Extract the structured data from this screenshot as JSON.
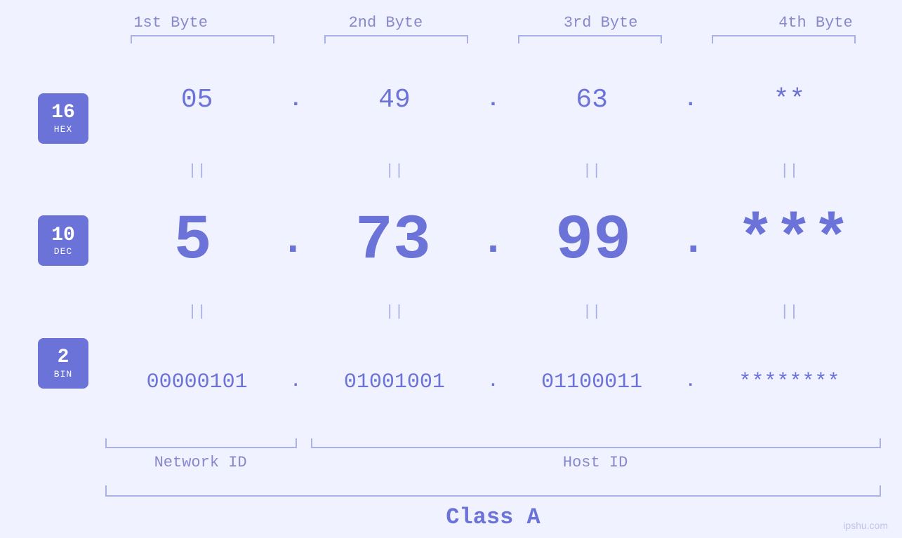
{
  "header": {
    "bytes": [
      {
        "label": "1st Byte"
      },
      {
        "label": "2nd Byte"
      },
      {
        "label": "3rd Byte"
      },
      {
        "label": "4th Byte"
      }
    ]
  },
  "bases": [
    {
      "number": "16",
      "label": "HEX"
    },
    {
      "number": "10",
      "label": "DEC"
    },
    {
      "number": "2",
      "label": "BIN"
    }
  ],
  "rows": {
    "hex": {
      "values": [
        "05",
        "49",
        "63",
        "**"
      ],
      "dots": [
        ".",
        ".",
        ".",
        ""
      ]
    },
    "dec": {
      "values": [
        "5",
        "73",
        "99",
        "***"
      ],
      "dots": [
        ".",
        ".",
        ".",
        ""
      ]
    },
    "bin": {
      "values": [
        "00000101",
        "01001001",
        "01100011",
        "********"
      ],
      "dots": [
        ".",
        ".",
        ".",
        ""
      ]
    }
  },
  "equals_symbol": "||",
  "labels": {
    "network_id": "Network ID",
    "host_id": "Host ID",
    "class": "Class A"
  },
  "watermark": "ipshu.com"
}
